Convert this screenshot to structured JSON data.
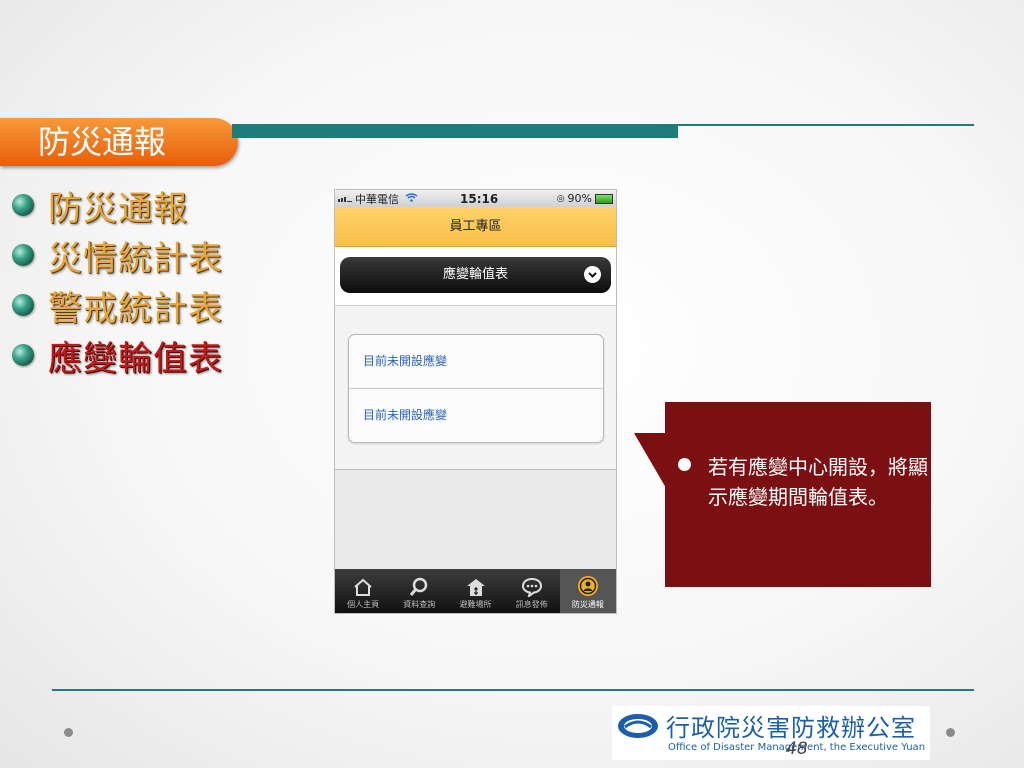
{
  "slide": {
    "title": "防災通報",
    "bullets": [
      {
        "label": "防災通報",
        "active": false
      },
      {
        "label": "災情統計表",
        "active": false
      },
      {
        "label": "警戒統計表",
        "active": false
      },
      {
        "label": "應變輪值表",
        "active": true
      }
    ],
    "page_number": "48"
  },
  "phone": {
    "status": {
      "carrier": "中華電信",
      "time": "15:16",
      "battery": "90%"
    },
    "appbar_title": "員工專區",
    "selector_label": "應變輪值表",
    "list_items": [
      "目前未開設應變",
      "目前未開設應變"
    ],
    "tabs": [
      {
        "label": "個人主頁",
        "icon": "home-icon"
      },
      {
        "label": "資料查詢",
        "icon": "search-icon"
      },
      {
        "label": "避難場所",
        "icon": "shelter-icon"
      },
      {
        "label": "訊息發佈",
        "icon": "message-icon"
      },
      {
        "label": "防災通報",
        "icon": "user-alert-icon"
      }
    ],
    "active_tab": 4
  },
  "callout": {
    "text": "若有應變中心開設，將顯示應變期間輪值表。"
  },
  "logo": {
    "name_cn": "行政院災害防救辦公室",
    "name_en": "Office of Disaster Management, the Executive Yuan"
  },
  "colors": {
    "accent_teal": "#1d7d7a",
    "title_orange": "#e85d0a",
    "callout_red": "#7b0f12",
    "bullet_gold": "#e8a63a",
    "bullet_active_red": "#c31818"
  }
}
